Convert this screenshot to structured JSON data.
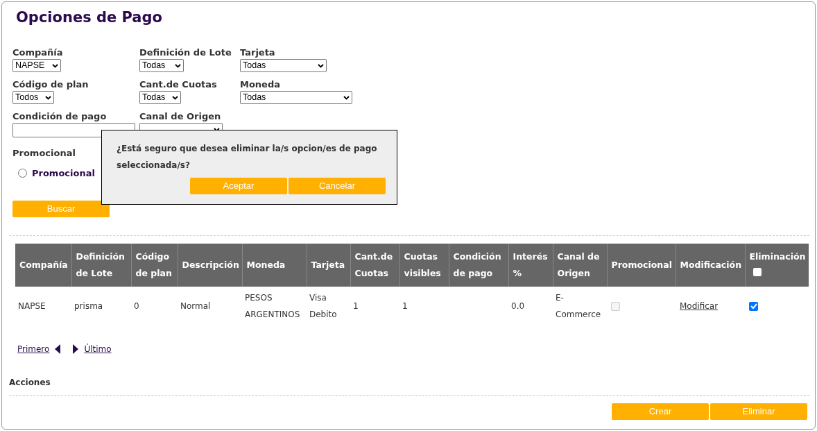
{
  "title": "Opciones de Pago",
  "filters": [
    {
      "label": "Compañía",
      "kind": "select",
      "value": "NAPSE"
    },
    {
      "label": "Definición de Lote",
      "kind": "select",
      "value": "Todas"
    },
    {
      "label": "Tarjeta",
      "kind": "select",
      "value": "Todas"
    },
    {
      "label": "Código de plan",
      "kind": "select",
      "value": "Todos"
    },
    {
      "label": "Cant.de Cuotas",
      "kind": "select",
      "value": "Todas"
    },
    {
      "label": "Moneda",
      "kind": "select",
      "value": "Todas"
    },
    {
      "label": "Condición de pago",
      "kind": "text"
    },
    {
      "label": "Canal de Origen",
      "kind": "select"
    }
  ],
  "promo": {
    "label": "Promocional",
    "options": [
      {
        "label": "Promocional",
        "selected": false
      }
    ]
  },
  "search_button": "Buscar",
  "dialog": {
    "message": "¿Está seguro que desea eliminar la/s opcion/es de pago seleccionada/s?",
    "buttons": [
      "Aceptar",
      "Cancelar"
    ]
  },
  "table": {
    "columns": [
      "Compañía",
      "Definición de Lote",
      "Código de plan",
      "Descripción",
      "Moneda",
      "Tarjeta",
      "Cant.de Cuotas",
      "Cuotas visibles",
      "Condición de pago",
      "Interés %",
      "Canal de Origen",
      "Promocional",
      "Modificación",
      "Eliminación"
    ],
    "select_all_checked": false,
    "rows": [
      {
        "cells": [
          {
            "kind": "text",
            "text": "NAPSE"
          },
          {
            "kind": "text",
            "text": "prisma"
          },
          {
            "kind": "text",
            "text": "0"
          },
          {
            "kind": "text",
            "text": "Normal"
          },
          {
            "kind": "text",
            "text": "PESOS ARGENTINOS"
          },
          {
            "kind": "text",
            "text": "Visa Debito"
          },
          {
            "kind": "text",
            "text": "1"
          },
          {
            "kind": "text",
            "text": "1"
          },
          {
            "kind": "empty"
          },
          {
            "kind": "text",
            "text": "0.0"
          },
          {
            "kind": "text",
            "text": "E-Commerce"
          },
          {
            "kind": "checkbox",
            "checked": false,
            "disabled": true
          },
          {
            "kind": "link",
            "text": "Modificar"
          },
          {
            "kind": "checkbox",
            "checked": true,
            "disabled": false
          }
        ]
      }
    ]
  },
  "pagination": {
    "first": "Primero",
    "last": "Último"
  },
  "actions": {
    "title": "Acciones",
    "buttons": [
      "Crear",
      "Eliminar"
    ]
  }
}
